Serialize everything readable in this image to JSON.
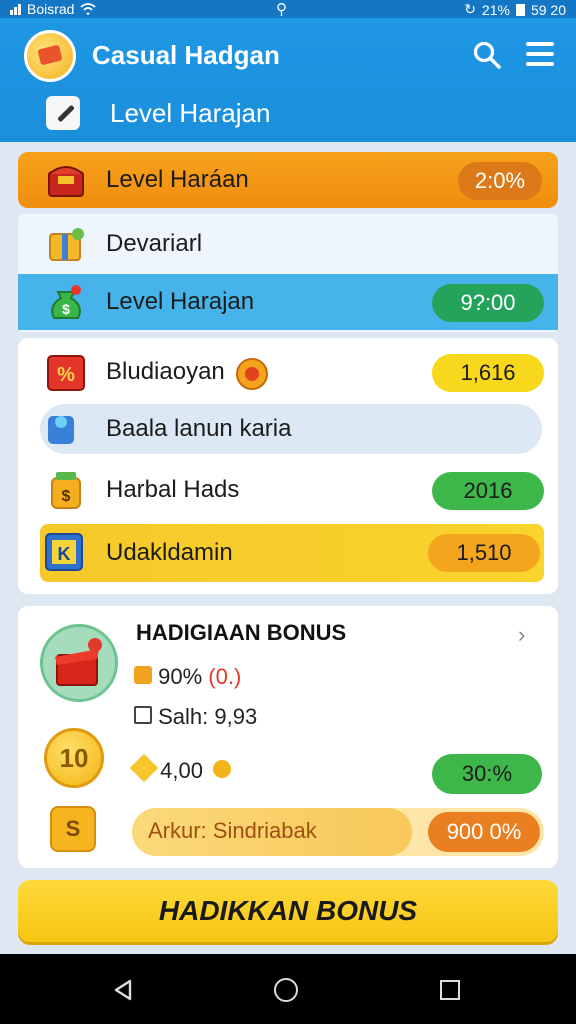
{
  "status_bar": {
    "carrier": "Boisrad",
    "right_text": "59 20",
    "battery": "21%"
  },
  "app": {
    "title": "Casual Hadgan",
    "subtitle": "Level Harajan"
  },
  "rows": {
    "top": {
      "label": "Level  Haráan",
      "value": "2:0%"
    },
    "devariarl": {
      "label": "Devariarl"
    },
    "level": {
      "label": "Level Harajan",
      "value": "9?:00"
    },
    "b1": {
      "label": "Bludiaoyan",
      "value": "1,616"
    },
    "b2": {
      "label": "Baala lanun karia"
    },
    "b3": {
      "label": "Harbal Hads",
      "value": "2016"
    },
    "b4": {
      "label": "Udakldamin",
      "value": "1,510"
    }
  },
  "bonus": {
    "title": "HADIGIAAN BONUS",
    "line1_value": "90%",
    "line1_extra": "(0.)",
    "line2": "Salh: 9,93",
    "coin_label": "10",
    "line3": "4,00",
    "line3_pill": "30:%",
    "s_coin": "S",
    "progress_label": "Arkur: Sindriabak",
    "progress_value": "900 0%",
    "progress_fraction": 0.68
  },
  "cta": {
    "label": "HADIKKAN BONUS"
  },
  "icons": [
    "wifi-icon",
    "search-icon",
    "menu-icon",
    "chest-icon",
    "coin-icon",
    "gift-icon",
    "back-icon",
    "home-icon",
    "recent-apps-icon"
  ]
}
